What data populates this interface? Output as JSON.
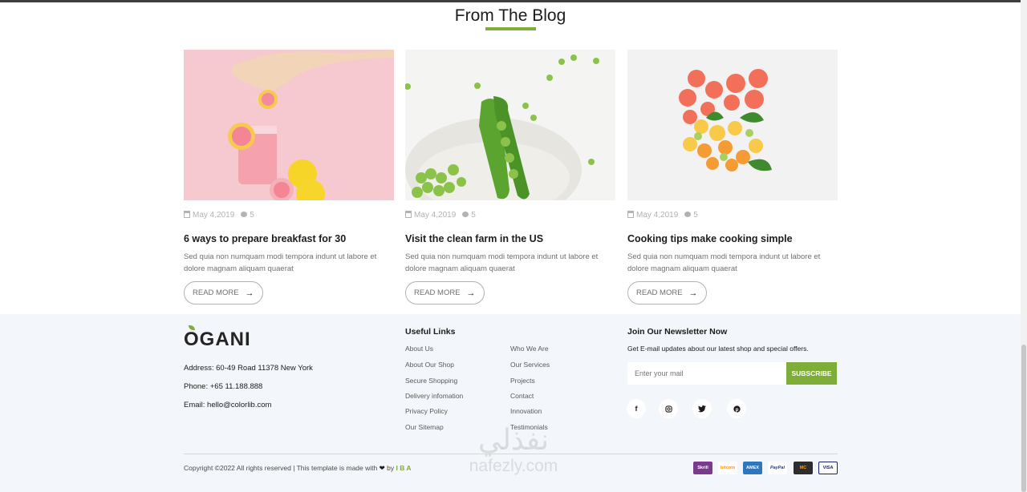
{
  "blog": {
    "title": "From The Blog",
    "posts": [
      {
        "date": "May 4,2019",
        "comments": "5",
        "title": "6 ways to prepare breakfast for 30",
        "excerpt": "Sed quia non numquam modi tempora indunt ut labore et dolore magnam aliquam quaerat",
        "read_more": "READ MORE",
        "image": "pink-drink-with-citrus"
      },
      {
        "date": "May 4,2019",
        "comments": "5",
        "title": "Visit the clean farm in the US",
        "excerpt": "Sed quia non numquam modi tempora indunt ut labore et dolore magnam aliquam quaerat",
        "read_more": "READ MORE",
        "image": "green-peas-in-bowl"
      },
      {
        "date": "May 4,2019",
        "comments": "5",
        "title": "Cooking tips make cooking simple",
        "excerpt": "Sed quia non numquam modi tempora indunt ut labore et dolore magnam aliquam quaerat",
        "read_more": "READ MORE",
        "image": "citrus-fruit-arrangement"
      }
    ]
  },
  "footer": {
    "logo": "OGANI",
    "address": "Address: 60-49 Road 11378 New York",
    "phone": "Phone: +65 11.188.888",
    "email": "Email: hello@colorlib.com",
    "useful_links": {
      "heading": "Useful Links",
      "col1": [
        "About Us",
        "About Our Shop",
        "Secure Shopping",
        "Delivery infomation",
        "Privacy Policy",
        "Our Sitemap"
      ],
      "col2": [
        "Who We Are",
        "Our Services",
        "Projects",
        "Contact",
        "Innovation",
        "Testimonials"
      ]
    },
    "newsletter": {
      "heading": "Join Our Newsletter Now",
      "text": "Get E-mail updates about our latest shop and special offers.",
      "placeholder": "Enter your mail",
      "button": "SUBSCRIBE"
    },
    "social": [
      "facebook-icon",
      "instagram-icon",
      "twitter-icon",
      "pinterest-icon"
    ],
    "copyright": {
      "prefix": "Copyright ©2022 All rights reserved | This template is made with",
      "by": "by",
      "brand": "I B A"
    },
    "payments": [
      "Skrill",
      "bitcoin",
      "AMEX",
      "PayPal",
      "MC",
      "VISA"
    ]
  },
  "watermark": {
    "arabic": "نفذلي",
    "latin": "nafezly.com"
  },
  "colors": {
    "accent": "#7fad39",
    "footer_bg": "#f3f6fa",
    "text_dark": "#1c1c1c",
    "text_muted": "#6f6f6f"
  }
}
